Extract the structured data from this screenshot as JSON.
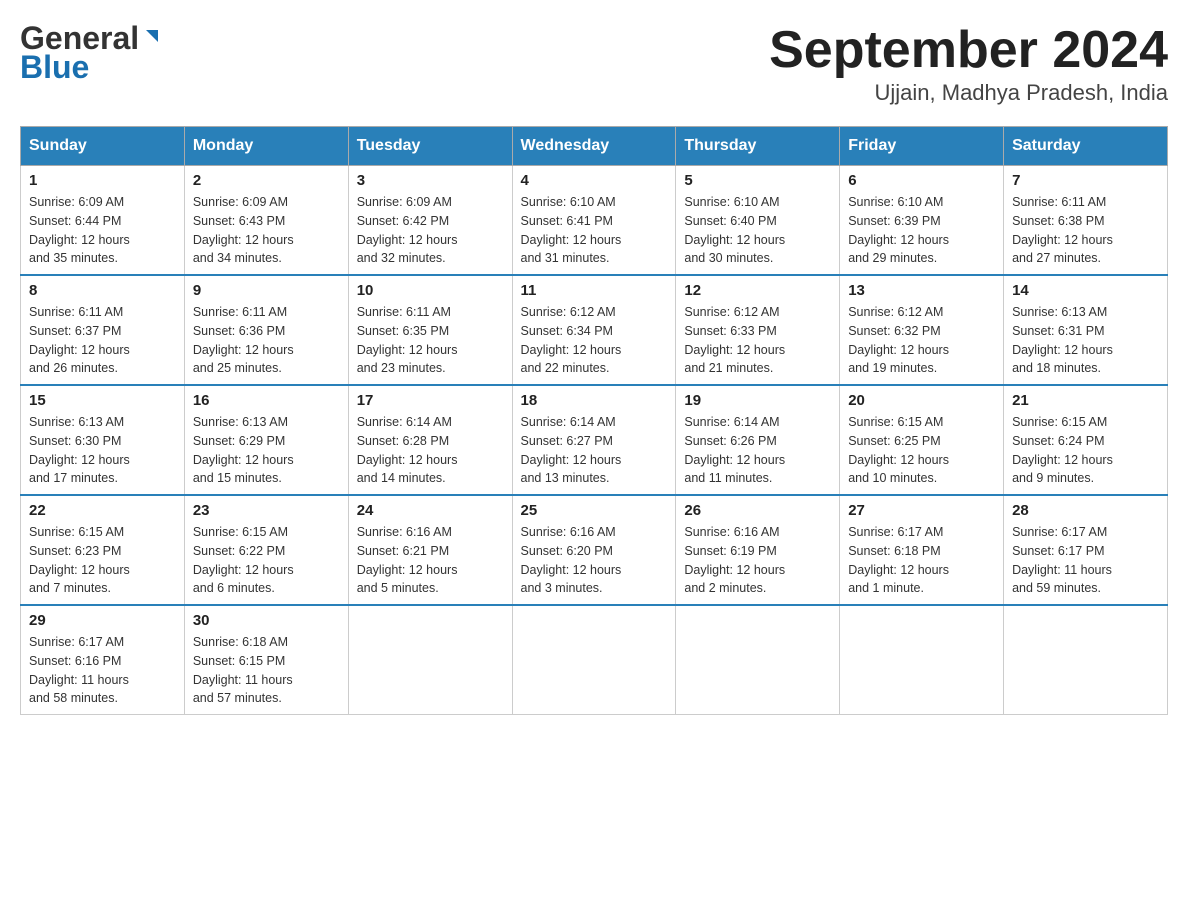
{
  "header": {
    "logo_text": "General Blue",
    "title": "September 2024",
    "subtitle": "Ujjain, Madhya Pradesh, India"
  },
  "days_of_week": [
    "Sunday",
    "Monday",
    "Tuesday",
    "Wednesday",
    "Thursday",
    "Friday",
    "Saturday"
  ],
  "weeks": [
    [
      {
        "day": "1",
        "sunrise": "6:09 AM",
        "sunset": "6:44 PM",
        "daylight": "12 hours and 35 minutes."
      },
      {
        "day": "2",
        "sunrise": "6:09 AM",
        "sunset": "6:43 PM",
        "daylight": "12 hours and 34 minutes."
      },
      {
        "day": "3",
        "sunrise": "6:09 AM",
        "sunset": "6:42 PM",
        "daylight": "12 hours and 32 minutes."
      },
      {
        "day": "4",
        "sunrise": "6:10 AM",
        "sunset": "6:41 PM",
        "daylight": "12 hours and 31 minutes."
      },
      {
        "day": "5",
        "sunrise": "6:10 AM",
        "sunset": "6:40 PM",
        "daylight": "12 hours and 30 minutes."
      },
      {
        "day": "6",
        "sunrise": "6:10 AM",
        "sunset": "6:39 PM",
        "daylight": "12 hours and 29 minutes."
      },
      {
        "day": "7",
        "sunrise": "6:11 AM",
        "sunset": "6:38 PM",
        "daylight": "12 hours and 27 minutes."
      }
    ],
    [
      {
        "day": "8",
        "sunrise": "6:11 AM",
        "sunset": "6:37 PM",
        "daylight": "12 hours and 26 minutes."
      },
      {
        "day": "9",
        "sunrise": "6:11 AM",
        "sunset": "6:36 PM",
        "daylight": "12 hours and 25 minutes."
      },
      {
        "day": "10",
        "sunrise": "6:11 AM",
        "sunset": "6:35 PM",
        "daylight": "12 hours and 23 minutes."
      },
      {
        "day": "11",
        "sunrise": "6:12 AM",
        "sunset": "6:34 PM",
        "daylight": "12 hours and 22 minutes."
      },
      {
        "day": "12",
        "sunrise": "6:12 AM",
        "sunset": "6:33 PM",
        "daylight": "12 hours and 21 minutes."
      },
      {
        "day": "13",
        "sunrise": "6:12 AM",
        "sunset": "6:32 PM",
        "daylight": "12 hours and 19 minutes."
      },
      {
        "day": "14",
        "sunrise": "6:13 AM",
        "sunset": "6:31 PM",
        "daylight": "12 hours and 18 minutes."
      }
    ],
    [
      {
        "day": "15",
        "sunrise": "6:13 AM",
        "sunset": "6:30 PM",
        "daylight": "12 hours and 17 minutes."
      },
      {
        "day": "16",
        "sunrise": "6:13 AM",
        "sunset": "6:29 PM",
        "daylight": "12 hours and 15 minutes."
      },
      {
        "day": "17",
        "sunrise": "6:14 AM",
        "sunset": "6:28 PM",
        "daylight": "12 hours and 14 minutes."
      },
      {
        "day": "18",
        "sunrise": "6:14 AM",
        "sunset": "6:27 PM",
        "daylight": "12 hours and 13 minutes."
      },
      {
        "day": "19",
        "sunrise": "6:14 AM",
        "sunset": "6:26 PM",
        "daylight": "12 hours and 11 minutes."
      },
      {
        "day": "20",
        "sunrise": "6:15 AM",
        "sunset": "6:25 PM",
        "daylight": "12 hours and 10 minutes."
      },
      {
        "day": "21",
        "sunrise": "6:15 AM",
        "sunset": "6:24 PM",
        "daylight": "12 hours and 9 minutes."
      }
    ],
    [
      {
        "day": "22",
        "sunrise": "6:15 AM",
        "sunset": "6:23 PM",
        "daylight": "12 hours and 7 minutes."
      },
      {
        "day": "23",
        "sunrise": "6:15 AM",
        "sunset": "6:22 PM",
        "daylight": "12 hours and 6 minutes."
      },
      {
        "day": "24",
        "sunrise": "6:16 AM",
        "sunset": "6:21 PM",
        "daylight": "12 hours and 5 minutes."
      },
      {
        "day": "25",
        "sunrise": "6:16 AM",
        "sunset": "6:20 PM",
        "daylight": "12 hours and 3 minutes."
      },
      {
        "day": "26",
        "sunrise": "6:16 AM",
        "sunset": "6:19 PM",
        "daylight": "12 hours and 2 minutes."
      },
      {
        "day": "27",
        "sunrise": "6:17 AM",
        "sunset": "6:18 PM",
        "daylight": "12 hours and 1 minute."
      },
      {
        "day": "28",
        "sunrise": "6:17 AM",
        "sunset": "6:17 PM",
        "daylight": "11 hours and 59 minutes."
      }
    ],
    [
      {
        "day": "29",
        "sunrise": "6:17 AM",
        "sunset": "6:16 PM",
        "daylight": "11 hours and 58 minutes."
      },
      {
        "day": "30",
        "sunrise": "6:18 AM",
        "sunset": "6:15 PM",
        "daylight": "11 hours and 57 minutes."
      },
      null,
      null,
      null,
      null,
      null
    ]
  ],
  "labels": {
    "sunrise": "Sunrise:",
    "sunset": "Sunset:",
    "daylight": "Daylight:"
  }
}
